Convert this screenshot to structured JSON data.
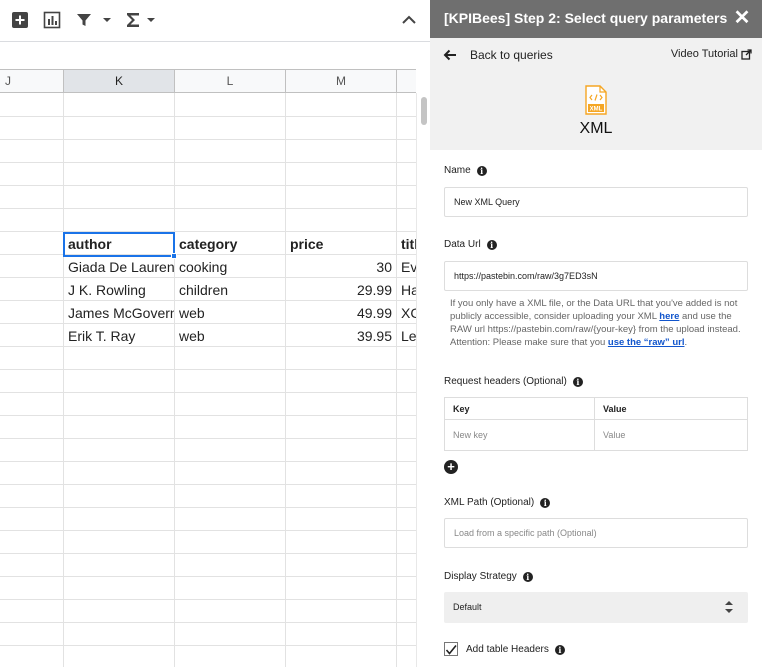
{
  "toolbar": {
    "icons": [
      "insert-comment-icon",
      "insert-chart-icon",
      "filter-icon",
      "dropdown-arrow-icon",
      "sum-functions-icon",
      "collapse-toolbar-icon"
    ]
  },
  "sheet": {
    "columns": [
      "J",
      "K",
      "L",
      "M",
      ""
    ],
    "selected_column": "K",
    "header_row": {
      "author": "author",
      "category": "category",
      "price": "price",
      "title": "titl"
    },
    "rows": [
      {
        "author": "Giada De Laurentiis",
        "category": "cooking",
        "price": "30",
        "title": "Ev"
      },
      {
        "author": "J K. Rowling",
        "category": "children",
        "price": "29.99",
        "title": "Ha"
      },
      {
        "author": "James McGovern",
        "category": "web",
        "price": "49.99",
        "title": "XC"
      },
      {
        "author": "Erik T. Ray",
        "category": "web",
        "price": "39.95",
        "title": "Le"
      }
    ]
  },
  "panel": {
    "title": "[KPIBees] Step 2: Select query parameters",
    "close": "✕",
    "back_label": "Back to queries",
    "tutorial_label": "Video Tutorial",
    "source_icon_text": "XML",
    "source_label": "XML",
    "name": {
      "label": "Name",
      "value": "New XML Query"
    },
    "data_url": {
      "label": "Data Url",
      "value": "https://pastebin.com/raw/3g7ED3sN"
    },
    "help": {
      "part1": "If you only have a XML file, or the Data URL that you've added is not publicly accessible, consider uploading your XML ",
      "link1": "here",
      "part2": " and use the RAW url https://pastebin.com/raw/{your-key} from the upload instead. Attention: Please make sure that you ",
      "link2": "use the “raw” url",
      "part3": "."
    },
    "headers": {
      "label": "Request headers (Optional)",
      "key_header": "Key",
      "value_header": "Value",
      "key_placeholder": "New key",
      "value_placeholder": "Value",
      "add": "+"
    },
    "xml_path": {
      "label": "XML Path (Optional)",
      "placeholder": "Load from a specific path (Optional)"
    },
    "display_strategy": {
      "label": "Display Strategy",
      "value": "Default"
    },
    "table_headers": {
      "label": "Add table Headers",
      "checked": true
    }
  },
  "colors": {
    "panel_bar": "#6f6f6f",
    "accent_blue": "#1a73e8",
    "link": "#1155cc",
    "xml_orange": "#f5a623"
  }
}
